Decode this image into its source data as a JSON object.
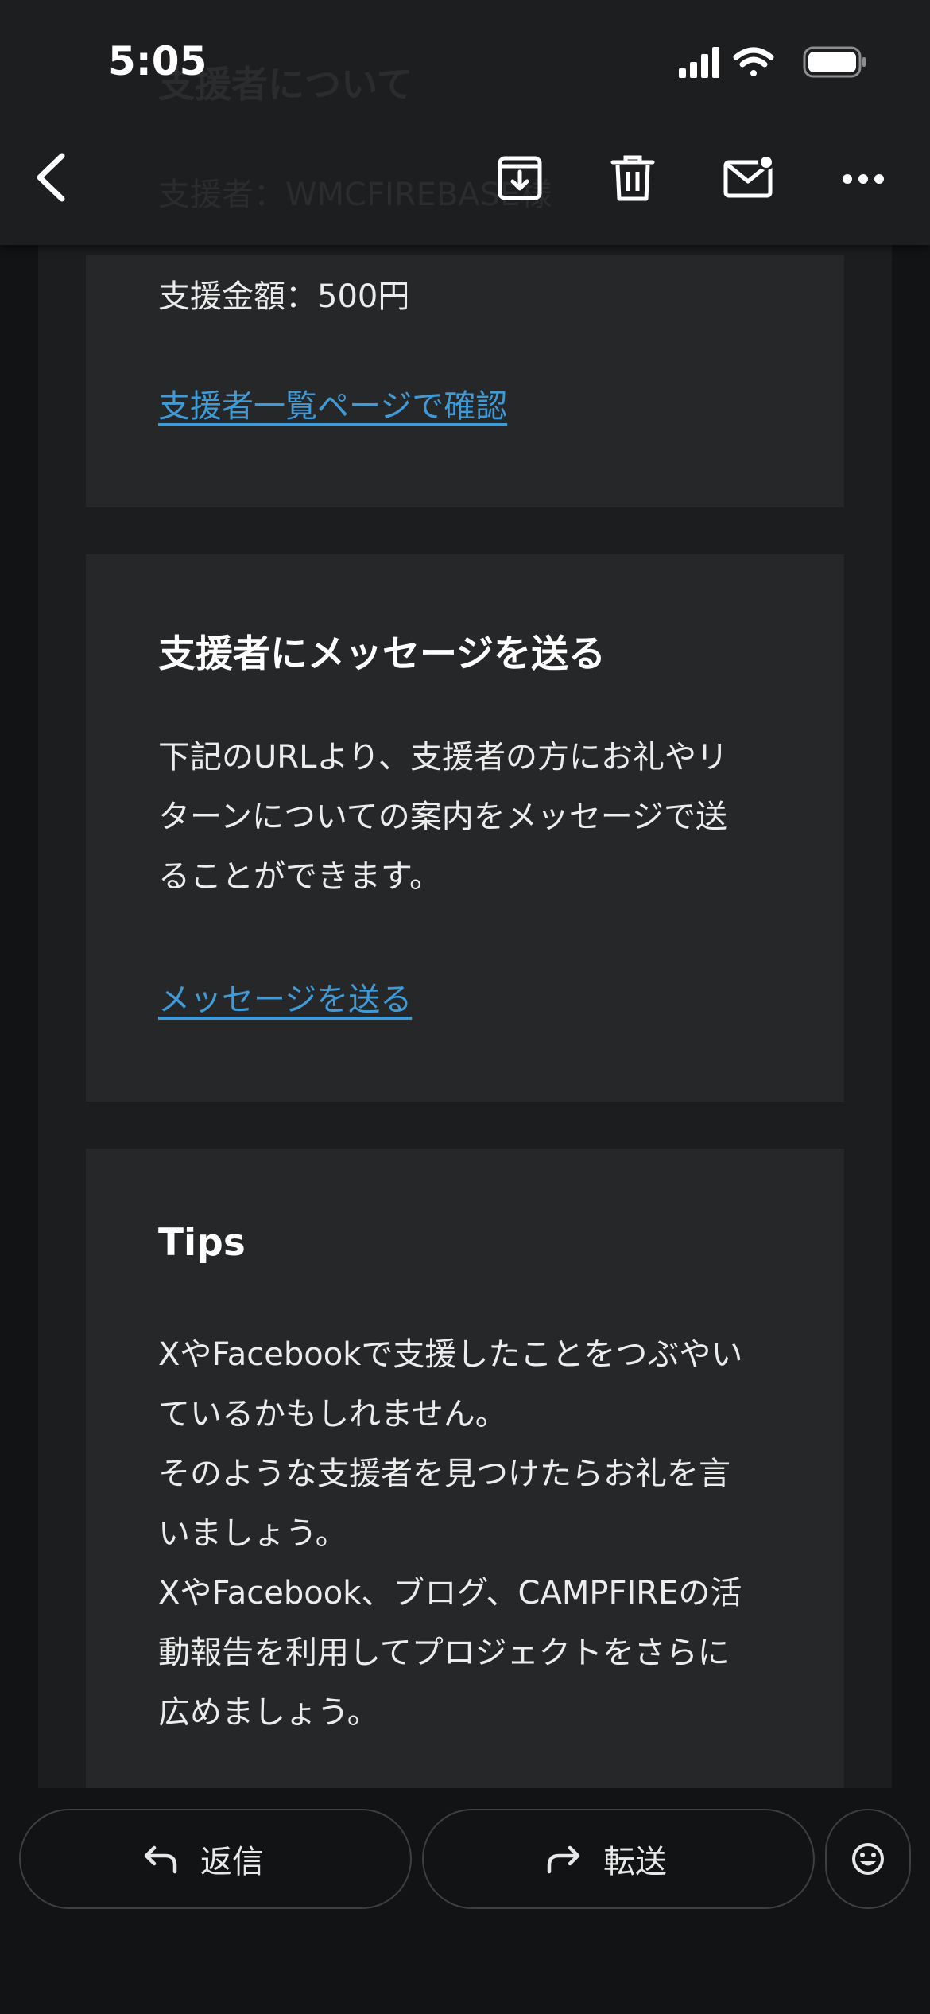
{
  "status_bar": {
    "time": "5:05"
  },
  "header": {
    "ghost_line1": "支援者について",
    "ghost_line2": "支援者：WMCFIREBASE様"
  },
  "email": {
    "amount_card": {
      "amount_text": "支援金額：500円",
      "link_label": "支援者一覧ページで確認"
    },
    "message_card": {
      "heading": "支援者にメッセージを送る",
      "body": "下記のURLより、支援者の方にお礼やリ\nターンについての案内をメッセージで送\nることができます。",
      "link_label": "メッセージを送る"
    },
    "tips_card": {
      "heading": "Tips",
      "body": "XやFacebookで支援したことをつぶやい\nているかもしれません。\nそのような支援者を見つけたらお礼を言\nいましょう。\nXやFacebook、ブログ、CAMPFIREの活\n動報告を利用してプロジェクトをさらに\n広めましょう。"
    }
  },
  "bottom_bar": {
    "reply_label": "返信",
    "forward_label": "転送"
  },
  "colors": {
    "link": "#3f9ad6",
    "card": "#262729",
    "frame": "#1c1d1f",
    "background": "#121314"
  }
}
